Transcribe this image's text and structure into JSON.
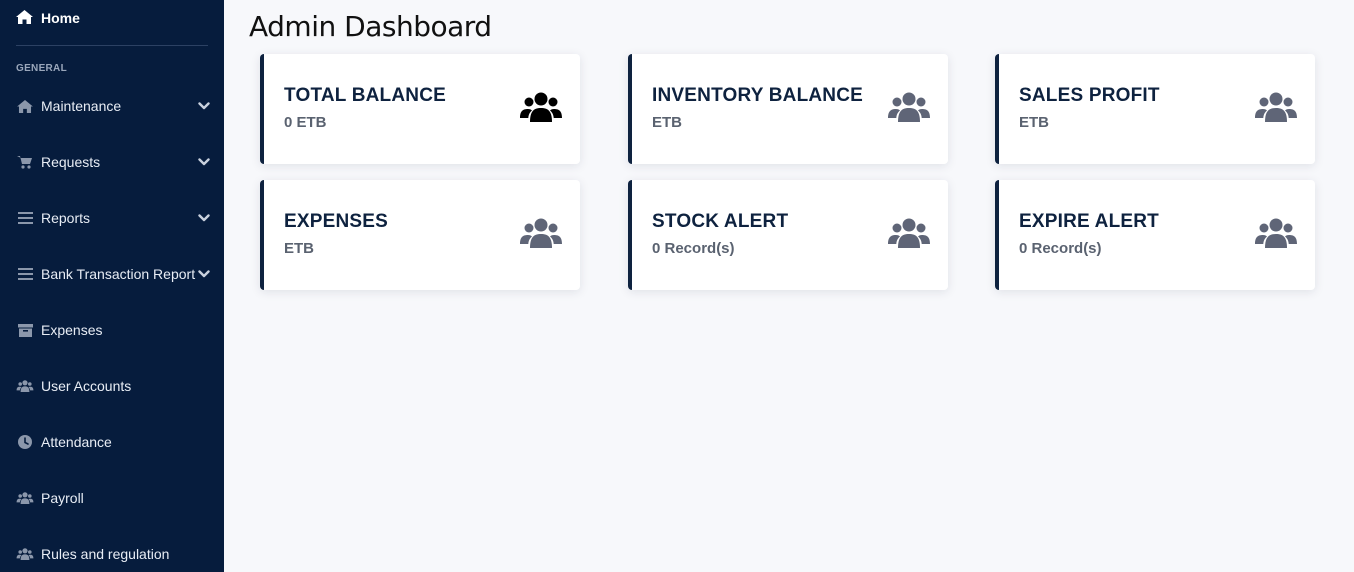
{
  "sidebar": {
    "home_label": "Home",
    "section_heading": "GENERAL",
    "items": [
      {
        "label": "Maintenance",
        "icon": "home-icon",
        "has_chevron": true
      },
      {
        "label": "Requests",
        "icon": "cart-icon",
        "has_chevron": true
      },
      {
        "label": "Reports",
        "icon": "list-icon",
        "has_chevron": true
      },
      {
        "label": "Bank Transaction Report",
        "icon": "list-icon",
        "has_chevron": true
      },
      {
        "label": "Expenses",
        "icon": "archive-icon",
        "has_chevron": false
      },
      {
        "label": "User Accounts",
        "icon": "users-icon",
        "has_chevron": false
      },
      {
        "label": "Attendance",
        "icon": "clock-icon",
        "has_chevron": false
      },
      {
        "label": "Payroll",
        "icon": "users-icon",
        "has_chevron": false
      },
      {
        "label": "Rules and regulation",
        "icon": "users-icon",
        "has_chevron": false
      }
    ]
  },
  "main": {
    "title": "Admin Dashboard",
    "cards": [
      {
        "title": "TOTAL BALANCE",
        "value": "0 ETB",
        "icon": "users-icon",
        "icon_color": "#000000"
      },
      {
        "title": "INVENTORY BALANCE",
        "value": "ETB",
        "icon": "users-icon",
        "icon_color": "#5f6577"
      },
      {
        "title": "SALES PROFIT",
        "value": "ETB",
        "icon": "users-icon",
        "icon_color": "#5f6577"
      },
      {
        "title": "EXPENSES",
        "value": "ETB",
        "icon": "users-icon",
        "icon_color": "#5f6577"
      },
      {
        "title": "STOCK ALERT",
        "value": "0 Record(s)",
        "icon": "users-icon",
        "icon_color": "#5f6577"
      },
      {
        "title": "EXPIRE ALERT",
        "value": "0 Record(s)",
        "icon": "users-icon",
        "icon_color": "#5f6577"
      }
    ]
  },
  "colors": {
    "sidebar_bg": "#061c3d",
    "card_accent": "#0e223f",
    "page_bg": "#f7f8fb"
  }
}
